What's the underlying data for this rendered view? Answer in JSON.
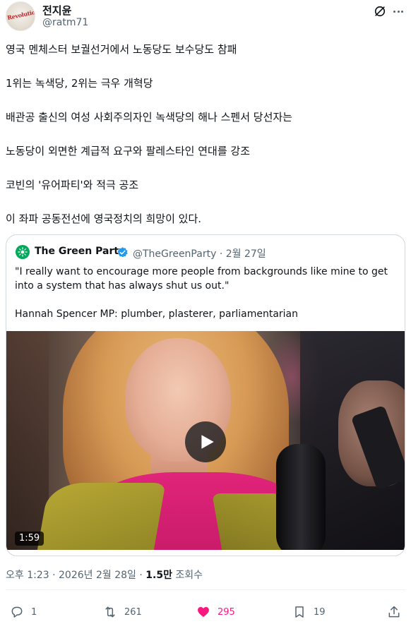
{
  "author": {
    "display_name": "전지윤",
    "handle": "@ratm71",
    "avatar_text": "Revolution"
  },
  "tweet": {
    "paragraphs": [
      "영국 멘체스터 보궐선거에서 노동당도 보수당도 참패",
      "1위는 녹색당, 2위는 극우 개혁당",
      "배관공 출신의 여성 사회주의자인 녹색당의 해나 스펜서 당선자는",
      "노동당이 외면한 계급적 요구와 팔레스타인 연대를 강조",
      "코빈의 '유어파티'와 적극 공조",
      "이 좌파 공동전선에 영국정치의 희망이 있다."
    ]
  },
  "quote": {
    "name": "The Green Party",
    "handle": "@TheGreenParty",
    "separator": "·",
    "date": "2월 27일",
    "quote_text": "\"I really want to encourage more people from backgrounds like mine to get into a system that has always shut us out.\"",
    "caption": "Hannah Spencer MP: plumber, plasterer, parliamentarian",
    "video_duration": "1:59"
  },
  "meta": {
    "time": "오후 1:23",
    "date": "2026년 2월 28일",
    "separator": "·",
    "views": "1.5만",
    "views_label": "조회수"
  },
  "actions": {
    "replies": "1",
    "retweets": "261",
    "likes": "295",
    "bookmarks": "19"
  },
  "colors": {
    "like_pink": "#f91880",
    "green_party": "#02a95b",
    "verified_blue": "#1d9bf0",
    "muted_text": "#536471"
  },
  "icons": [
    "grok-icon",
    "more-icon",
    "verified-icon",
    "play-icon",
    "reply-icon",
    "retweet-icon",
    "heart-icon",
    "bookmark-icon",
    "share-icon"
  ]
}
